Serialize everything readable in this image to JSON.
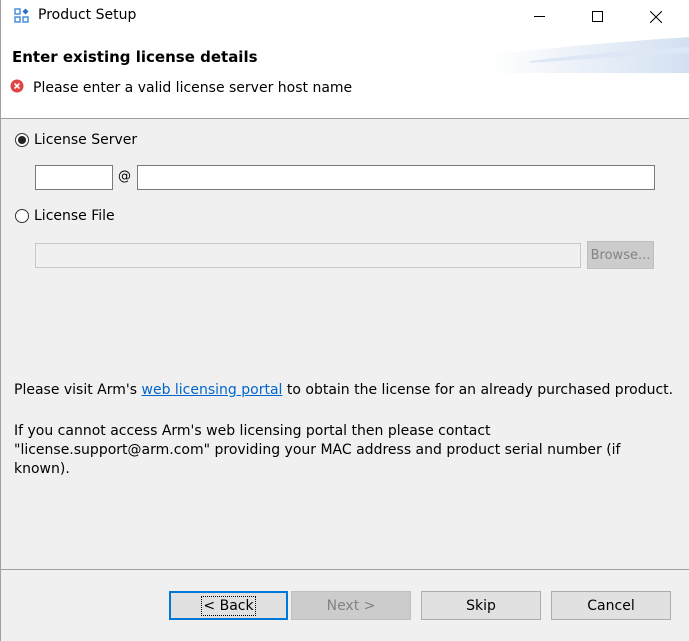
{
  "window": {
    "title": "Product Setup",
    "app_icon": "product-setup-icon",
    "controls": {
      "minimize": "minimize-icon",
      "maximize": "maximize-icon",
      "close": "close-icon"
    }
  },
  "header": {
    "title": "Enter existing license details",
    "error_icon": "error-icon",
    "error_message": "Please enter a valid license server host name"
  },
  "license_server": {
    "label": "License Server",
    "selected": true,
    "user_value": "",
    "at_symbol": "@",
    "host_value": ""
  },
  "license_file": {
    "label": "License File",
    "selected": false,
    "path_value": "",
    "browse_label": "Browse..."
  },
  "info": {
    "visit_prefix": "Please visit Arm's ",
    "portal_link": "web licensing portal",
    "visit_suffix": " to obtain the license for an already purchased product.",
    "contact_text": "If you cannot access Arm's web licensing portal then please contact \"license.support@arm.com\" providing your MAC address and product serial number (if known)."
  },
  "buttons": {
    "back": "< Back",
    "next": "Next >",
    "skip": "Skip",
    "cancel": "Cancel"
  },
  "colors": {
    "link": "#0066cc",
    "error": "#e04343",
    "focus_border": "#0078d7"
  }
}
